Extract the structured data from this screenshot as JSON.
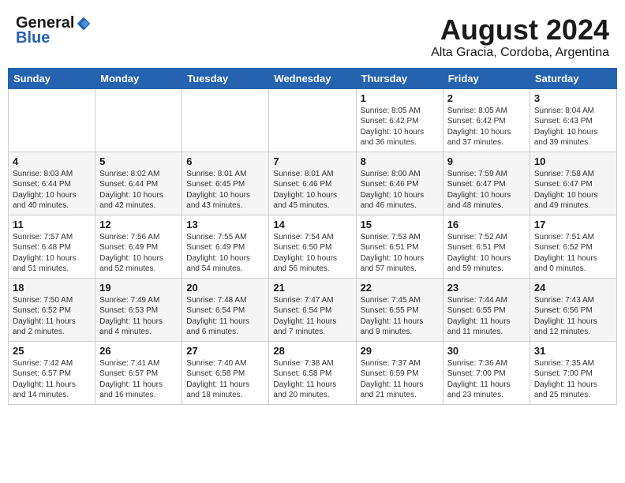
{
  "header": {
    "logo_general": "General",
    "logo_blue": "Blue",
    "month": "August 2024",
    "location": "Alta Gracia, Cordoba, Argentina"
  },
  "weekdays": [
    "Sunday",
    "Monday",
    "Tuesday",
    "Wednesday",
    "Thursday",
    "Friday",
    "Saturday"
  ],
  "weeks": [
    [
      {
        "day": "",
        "info": ""
      },
      {
        "day": "",
        "info": ""
      },
      {
        "day": "",
        "info": ""
      },
      {
        "day": "",
        "info": ""
      },
      {
        "day": "1",
        "info": "Sunrise: 8:05 AM\nSunset: 6:42 PM\nDaylight: 10 hours\nand 36 minutes."
      },
      {
        "day": "2",
        "info": "Sunrise: 8:05 AM\nSunset: 6:42 PM\nDaylight: 10 hours\nand 37 minutes."
      },
      {
        "day": "3",
        "info": "Sunrise: 8:04 AM\nSunset: 6:43 PM\nDaylight: 10 hours\nand 39 minutes."
      }
    ],
    [
      {
        "day": "4",
        "info": "Sunrise: 8:03 AM\nSunset: 6:44 PM\nDaylight: 10 hours\nand 40 minutes."
      },
      {
        "day": "5",
        "info": "Sunrise: 8:02 AM\nSunset: 6:44 PM\nDaylight: 10 hours\nand 42 minutes."
      },
      {
        "day": "6",
        "info": "Sunrise: 8:01 AM\nSunset: 6:45 PM\nDaylight: 10 hours\nand 43 minutes."
      },
      {
        "day": "7",
        "info": "Sunrise: 8:01 AM\nSunset: 6:46 PM\nDaylight: 10 hours\nand 45 minutes."
      },
      {
        "day": "8",
        "info": "Sunrise: 8:00 AM\nSunset: 6:46 PM\nDaylight: 10 hours\nand 46 minutes."
      },
      {
        "day": "9",
        "info": "Sunrise: 7:59 AM\nSunset: 6:47 PM\nDaylight: 10 hours\nand 48 minutes."
      },
      {
        "day": "10",
        "info": "Sunrise: 7:58 AM\nSunset: 6:47 PM\nDaylight: 10 hours\nand 49 minutes."
      }
    ],
    [
      {
        "day": "11",
        "info": "Sunrise: 7:57 AM\nSunset: 6:48 PM\nDaylight: 10 hours\nand 51 minutes."
      },
      {
        "day": "12",
        "info": "Sunrise: 7:56 AM\nSunset: 6:49 PM\nDaylight: 10 hours\nand 52 minutes."
      },
      {
        "day": "13",
        "info": "Sunrise: 7:55 AM\nSunset: 6:49 PM\nDaylight: 10 hours\nand 54 minutes."
      },
      {
        "day": "14",
        "info": "Sunrise: 7:54 AM\nSunset: 6:50 PM\nDaylight: 10 hours\nand 56 minutes."
      },
      {
        "day": "15",
        "info": "Sunrise: 7:53 AM\nSunset: 6:51 PM\nDaylight: 10 hours\nand 57 minutes."
      },
      {
        "day": "16",
        "info": "Sunrise: 7:52 AM\nSunset: 6:51 PM\nDaylight: 10 hours\nand 59 minutes."
      },
      {
        "day": "17",
        "info": "Sunrise: 7:51 AM\nSunset: 6:52 PM\nDaylight: 11 hours\nand 0 minutes."
      }
    ],
    [
      {
        "day": "18",
        "info": "Sunrise: 7:50 AM\nSunset: 6:52 PM\nDaylight: 11 hours\nand 2 minutes."
      },
      {
        "day": "19",
        "info": "Sunrise: 7:49 AM\nSunset: 6:53 PM\nDaylight: 11 hours\nand 4 minutes."
      },
      {
        "day": "20",
        "info": "Sunrise: 7:48 AM\nSunset: 6:54 PM\nDaylight: 11 hours\nand 6 minutes."
      },
      {
        "day": "21",
        "info": "Sunrise: 7:47 AM\nSunset: 6:54 PM\nDaylight: 11 hours\nand 7 minutes."
      },
      {
        "day": "22",
        "info": "Sunrise: 7:45 AM\nSunset: 6:55 PM\nDaylight: 11 hours\nand 9 minutes."
      },
      {
        "day": "23",
        "info": "Sunrise: 7:44 AM\nSunset: 6:55 PM\nDaylight: 11 hours\nand 11 minutes."
      },
      {
        "day": "24",
        "info": "Sunrise: 7:43 AM\nSunset: 6:56 PM\nDaylight: 11 hours\nand 12 minutes."
      }
    ],
    [
      {
        "day": "25",
        "info": "Sunrise: 7:42 AM\nSunset: 6:57 PM\nDaylight: 11 hours\nand 14 minutes."
      },
      {
        "day": "26",
        "info": "Sunrise: 7:41 AM\nSunset: 6:57 PM\nDaylight: 11 hours\nand 16 minutes."
      },
      {
        "day": "27",
        "info": "Sunrise: 7:40 AM\nSunset: 6:58 PM\nDaylight: 11 hours\nand 18 minutes."
      },
      {
        "day": "28",
        "info": "Sunrise: 7:38 AM\nSunset: 6:58 PM\nDaylight: 11 hours\nand 20 minutes."
      },
      {
        "day": "29",
        "info": "Sunrise: 7:37 AM\nSunset: 6:59 PM\nDaylight: 11 hours\nand 21 minutes."
      },
      {
        "day": "30",
        "info": "Sunrise: 7:36 AM\nSunset: 7:00 PM\nDaylight: 11 hours\nand 23 minutes."
      },
      {
        "day": "31",
        "info": "Sunrise: 7:35 AM\nSunset: 7:00 PM\nDaylight: 11 hours\nand 25 minutes."
      }
    ]
  ]
}
